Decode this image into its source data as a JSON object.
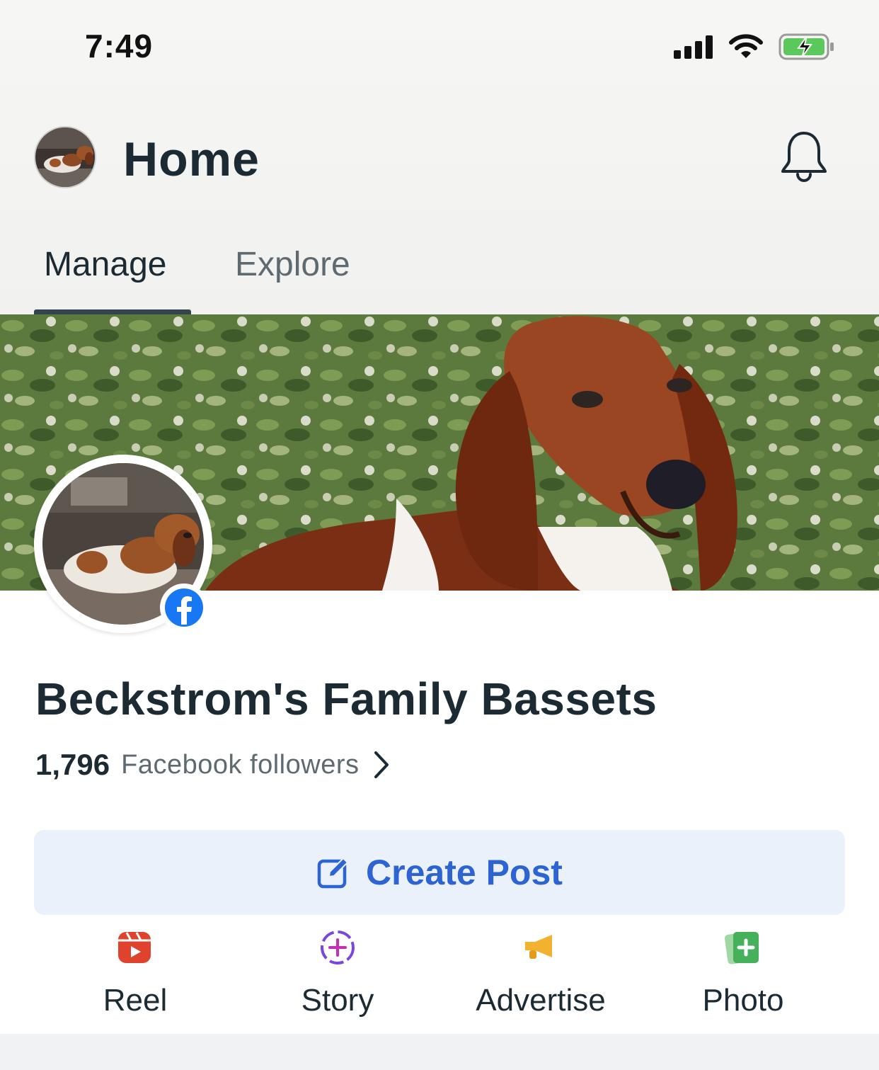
{
  "status_bar": {
    "time": "7:49"
  },
  "header": {
    "title": "Home"
  },
  "tabs": [
    {
      "label": "Manage"
    },
    {
      "label": "Explore"
    }
  ],
  "page": {
    "name": "Beckstrom's Family Bassets",
    "followers_count": "1,796",
    "followers_label": "Facebook followers"
  },
  "create_post": {
    "label": "Create Post"
  },
  "actions": [
    {
      "label": "Reel",
      "icon": "reel-icon",
      "color": "#e0432d"
    },
    {
      "label": "Story",
      "icon": "story-add-icon",
      "color": "#7b45e0"
    },
    {
      "label": "Advertise",
      "icon": "megaphone-icon",
      "color": "#f2b22f"
    },
    {
      "label": "Photo",
      "icon": "photo-add-icon",
      "color": "#46b05a"
    }
  ],
  "colors": {
    "accent": "#2c64d4",
    "button_bg": "#ebf1fb",
    "text": "#1c2b33",
    "muted": "#5f6a70"
  }
}
